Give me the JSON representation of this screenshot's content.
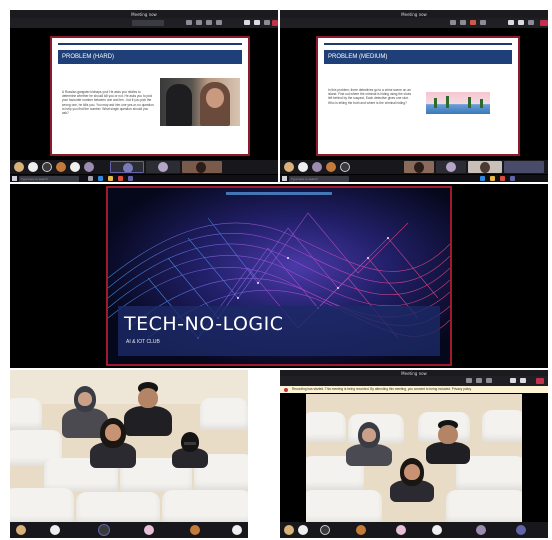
{
  "top_left": {
    "title": "Meeting now",
    "slide": {
      "title": "PROBLEM (HARD)",
      "body": "A Russian gangster kidnaps you! He asks you riddles to determine whether he should kill you or not. He asks you to pick your favourite number between one and ten - but if you pick the wrong one, he kills you. You may ask him one yes-or-no question to help you find the number. What single question should you ask?"
    }
  },
  "top_right": {
    "title": "Meeting now",
    "slide": {
      "title": "PROBLEM (MEDIUM)",
      "body": "In this problem, three detectives go to a crime scene on an island. Find out where the criminal is hiding using the clues left behind by the suspect. Each detective gives one clue. Who is telling the truth and where is the criminal hiding?"
    }
  },
  "search": {
    "placeholder": "Type here to search"
  },
  "main": {
    "title": "TECH-NO-LOGIC",
    "subtitle": "AI & IOT CLUB"
  },
  "bottom_right": {
    "title": "Meeting now",
    "banner": "Recording has started. This meeting is being recorded. By attending this meeting, you consent to being included. Privacy policy"
  },
  "colors": {
    "accent_red": "#c4314b",
    "teams_purple": "#6264a7",
    "slide_navy": "#1f3f78",
    "frame_red": "#a01a2e"
  },
  "icons": [
    "camera-icon",
    "mic-icon",
    "share-icon",
    "chat-icon",
    "more-icon",
    "leave-icon",
    "search-icon",
    "windows-icon"
  ]
}
